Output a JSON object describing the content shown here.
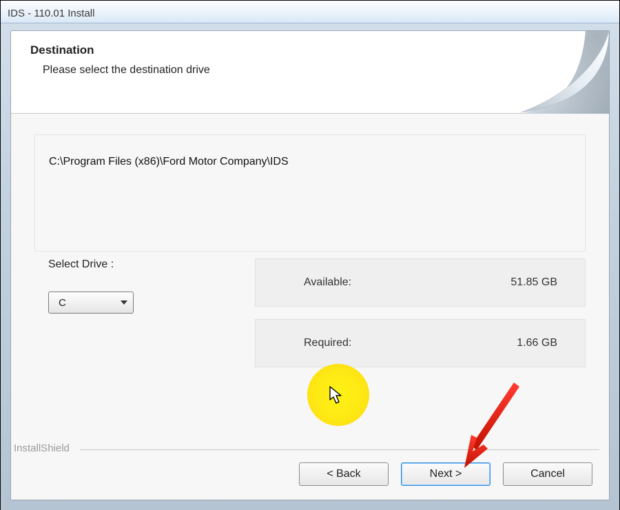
{
  "window": {
    "title": "IDS - 110.01 Install"
  },
  "header": {
    "title": "Destination",
    "subtitle": "Please select the destination drive"
  },
  "destination": {
    "path": "C:\\Program Files (x86)\\Ford Motor Company\\IDS",
    "select_label": "Select Drive :",
    "selected_drive": "C"
  },
  "stats": {
    "available_label": "Available:",
    "available_value": "51.85 GB",
    "required_label": "Required:",
    "required_value": "1.66 GB"
  },
  "footer": {
    "brand": "InstallShield",
    "back": "< Back",
    "next": "Next >",
    "cancel": "Cancel"
  }
}
